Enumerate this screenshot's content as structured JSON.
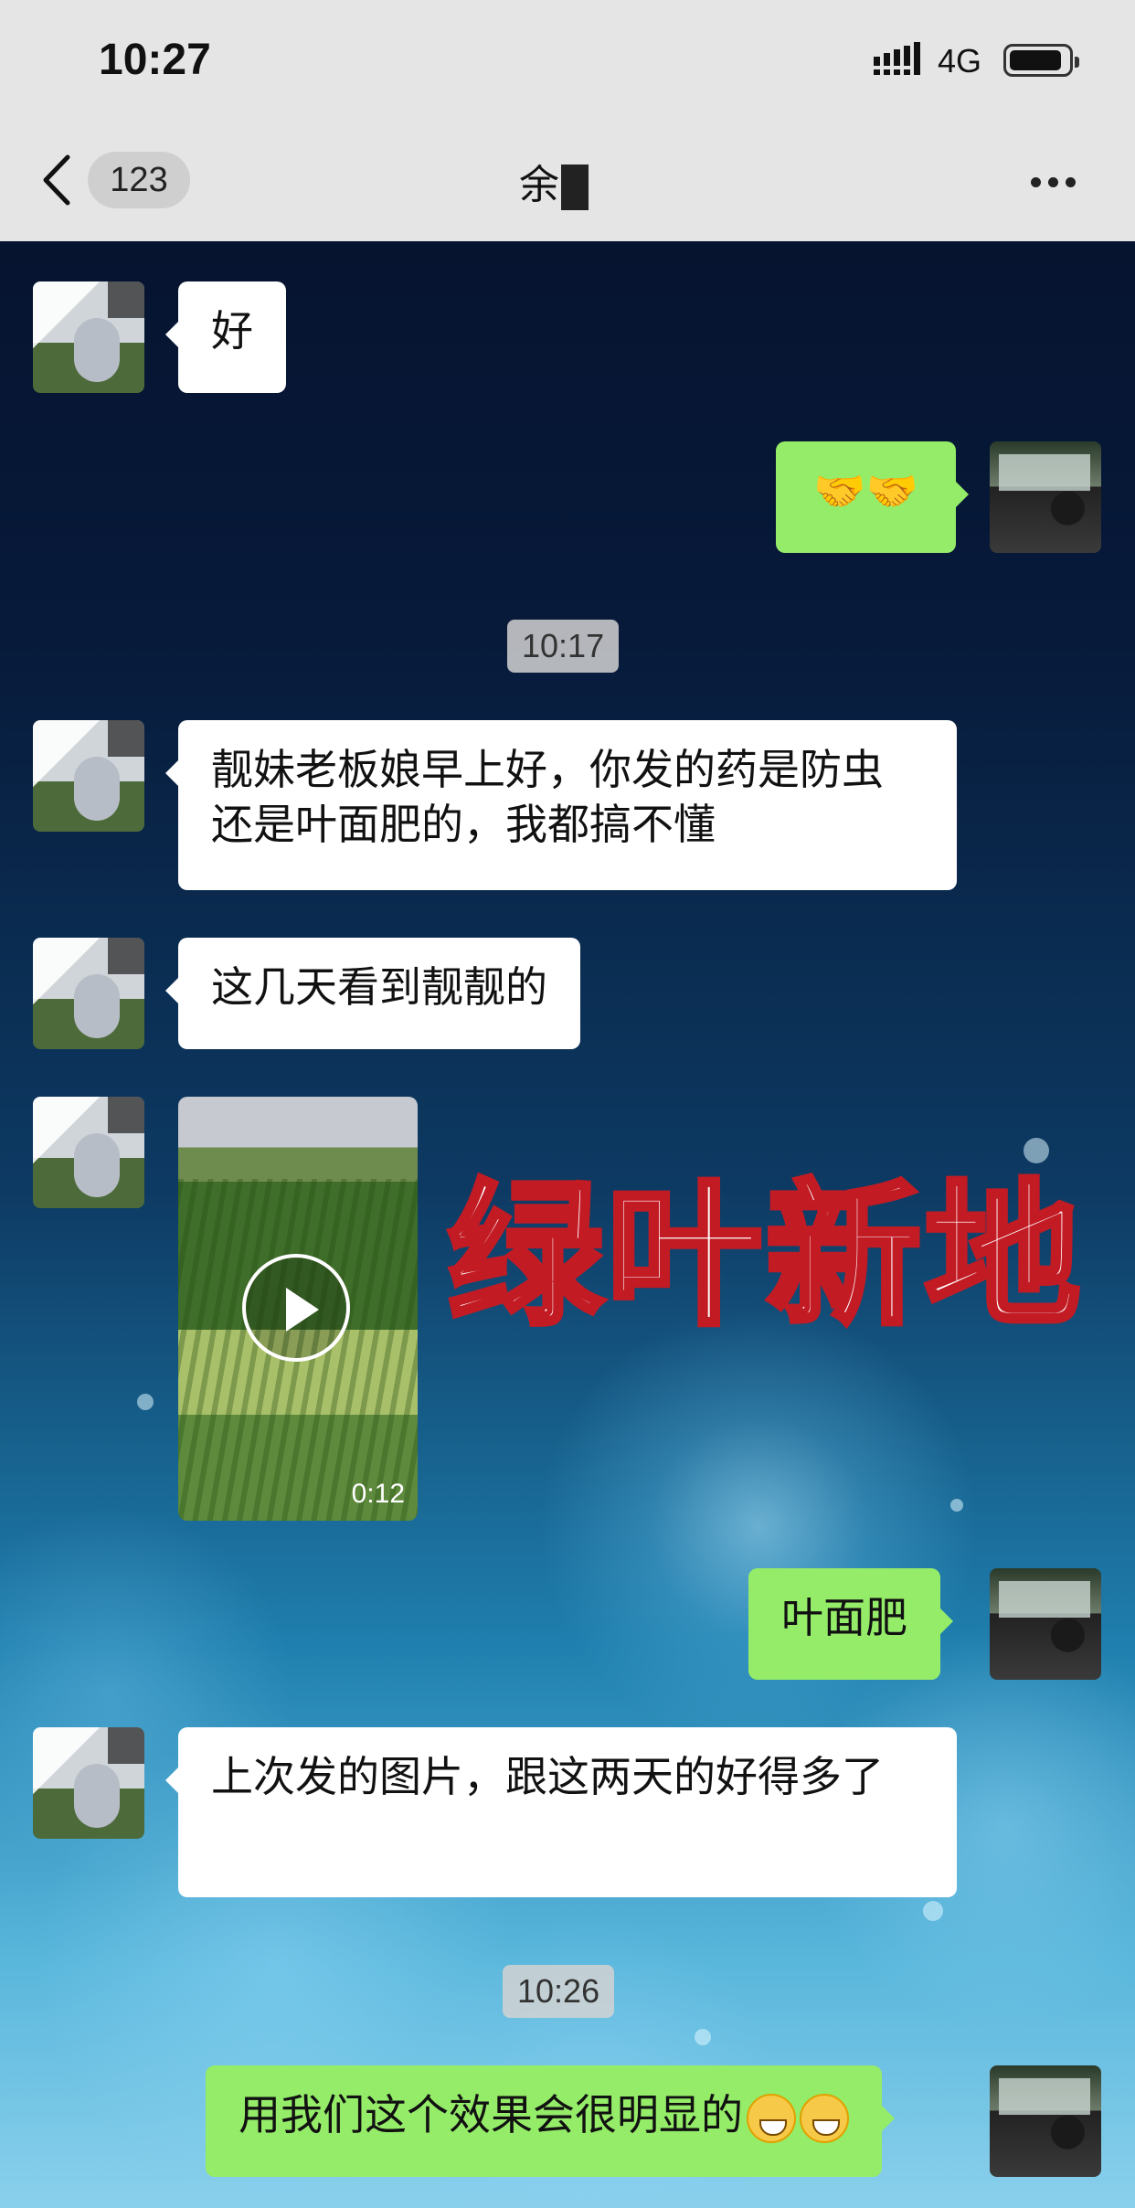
{
  "status": {
    "time": "10:27",
    "network": "4G"
  },
  "nav": {
    "back_count": "123",
    "title": "余"
  },
  "messages": {
    "m1": "好",
    "m2": "🤝🤝",
    "t1": "10:17",
    "m3": "靓妹老板娘早上好，你发的药是防虫还是叶面肥的，我都搞不懂",
    "m4": "这几天看到靓靓的",
    "video_duration": "0:12",
    "m5": "叶面肥",
    "m6": "上次发的图片，跟这两天的好得多了",
    "t2": "10:26",
    "m7": "用我们这个效果会很明显的"
  },
  "watermark": "绿叶新地",
  "colors": {
    "sent_bubble": "#95ec69",
    "received_bubble": "#ffffff",
    "watermark_stroke": "#c21b24"
  }
}
